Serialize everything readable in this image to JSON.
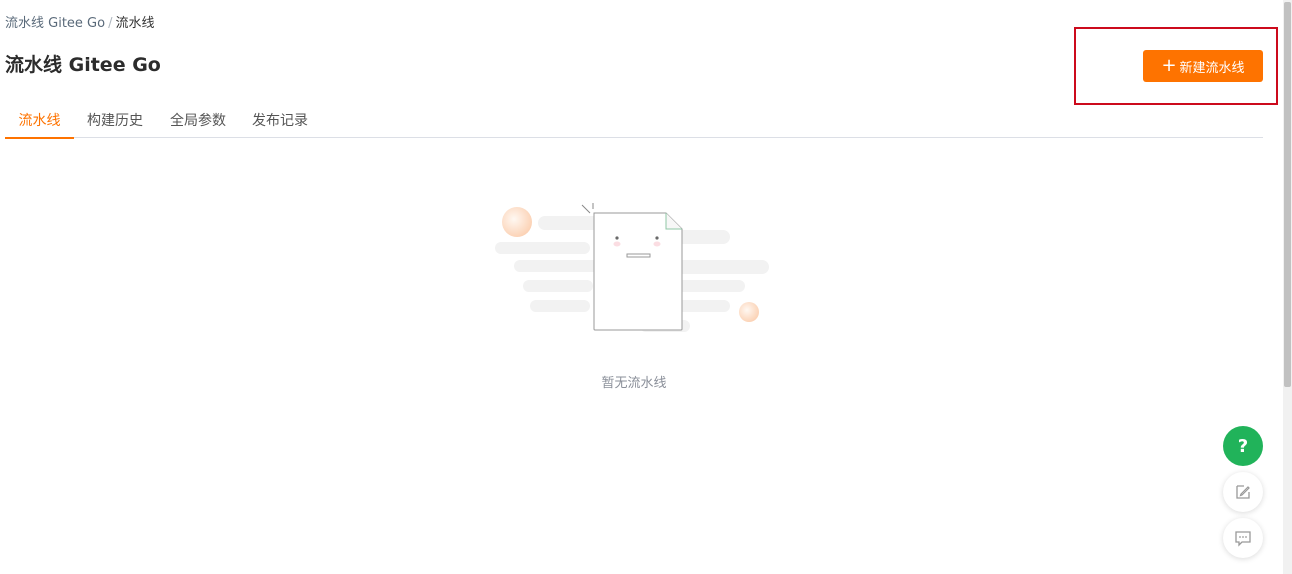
{
  "breadcrumb": {
    "parent": "流水线 Gitee Go",
    "separator": "/",
    "current": "流水线"
  },
  "header": {
    "title": "流水线 Gitee Go",
    "new_button_label": "新建流水线"
  },
  "tabs": [
    {
      "label": "流水线",
      "active": true
    },
    {
      "label": "构建历史",
      "active": false
    },
    {
      "label": "全局参数",
      "active": false
    },
    {
      "label": "发布记录",
      "active": false
    }
  ],
  "empty_state": {
    "message": "暂无流水线"
  },
  "floating": {
    "help_label": "?"
  },
  "colors": {
    "accent": "#fe7300",
    "help": "#21b35a",
    "highlight": "#cc0a1c"
  },
  "icons": [
    "plus-icon",
    "empty-document-icon",
    "question-icon",
    "edit-note-icon",
    "chat-bubble-icon"
  ]
}
